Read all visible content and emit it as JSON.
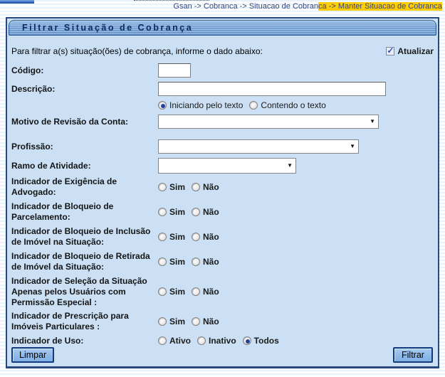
{
  "breadcrumb": {
    "plain": "Gsan -> Cobranca -> Situacao de Cobran",
    "highlighted": "ca -> Manter Situacao de Cobranca"
  },
  "panel": {
    "title": "Filtrar Situação de Cobrança",
    "intro": "Para filtrar a(s) situação(ões) de cobrança, informe o dado abaixo:",
    "atualizar_label": "Atualizar",
    "atualizar_checked": true
  },
  "fields": {
    "codigo": {
      "label": "Código:",
      "value": ""
    },
    "descricao": {
      "label": "Descrição:",
      "value": ""
    },
    "text_match": {
      "options": [
        {
          "label": "Iniciando pelo texto",
          "checked": true
        },
        {
          "label": "Contendo o texto",
          "checked": false
        }
      ]
    },
    "motivo_revisao": {
      "label": "Motivo de Revisão da Conta:",
      "value": ""
    },
    "profissao": {
      "label": "Profissão:",
      "value": ""
    },
    "ramo_atividade": {
      "label": "Ramo de Atividade:",
      "value": ""
    },
    "indicators": [
      {
        "label": "Indicador de Exigência de Advogado:",
        "options": [
          {
            "label": "Sim",
            "checked": false
          },
          {
            "label": "Não",
            "checked": false
          }
        ]
      },
      {
        "label": "Indicador de Bloqueio de Parcelamento:",
        "options": [
          {
            "label": "Sim",
            "checked": false
          },
          {
            "label": "Não",
            "checked": false
          }
        ]
      },
      {
        "label": "Indicador de Bloqueio de Inclusão de Imóvel na Situação:",
        "options": [
          {
            "label": "Sim",
            "checked": false
          },
          {
            "label": "Não",
            "checked": false
          }
        ]
      },
      {
        "label": "Indicador de Bloqueio de Retirada de Imóvel da Situação:",
        "options": [
          {
            "label": "Sim",
            "checked": false
          },
          {
            "label": "Não",
            "checked": false
          }
        ]
      },
      {
        "label": "Indicador de Seleção da Situação Apenas pelos Usuários com Permissão Especial :",
        "options": [
          {
            "label": "Sim",
            "checked": false
          },
          {
            "label": "Não",
            "checked": false
          }
        ]
      },
      {
        "label": "Indicador de Prescrição para Imóveis Particulares :",
        "options": [
          {
            "label": "Sim",
            "checked": false
          },
          {
            "label": "Não",
            "checked": false
          }
        ]
      }
    ],
    "uso": {
      "label": "Indicador de Uso:",
      "options": [
        {
          "label": "Ativo",
          "checked": false
        },
        {
          "label": "Inativo",
          "checked": false
        },
        {
          "label": "Todos",
          "checked": true
        }
      ]
    }
  },
  "buttons": {
    "limpar": "Limpar",
    "filtrar": "Filtrar"
  },
  "colors": {
    "panel_bg": "#cbe0f4",
    "panel_border": "#29497f",
    "breadcrumb_highlight": "#ffcc00",
    "header_text": "#0d2a63",
    "button_bg": "#8fbae9",
    "radio_dot": "#25439c"
  }
}
